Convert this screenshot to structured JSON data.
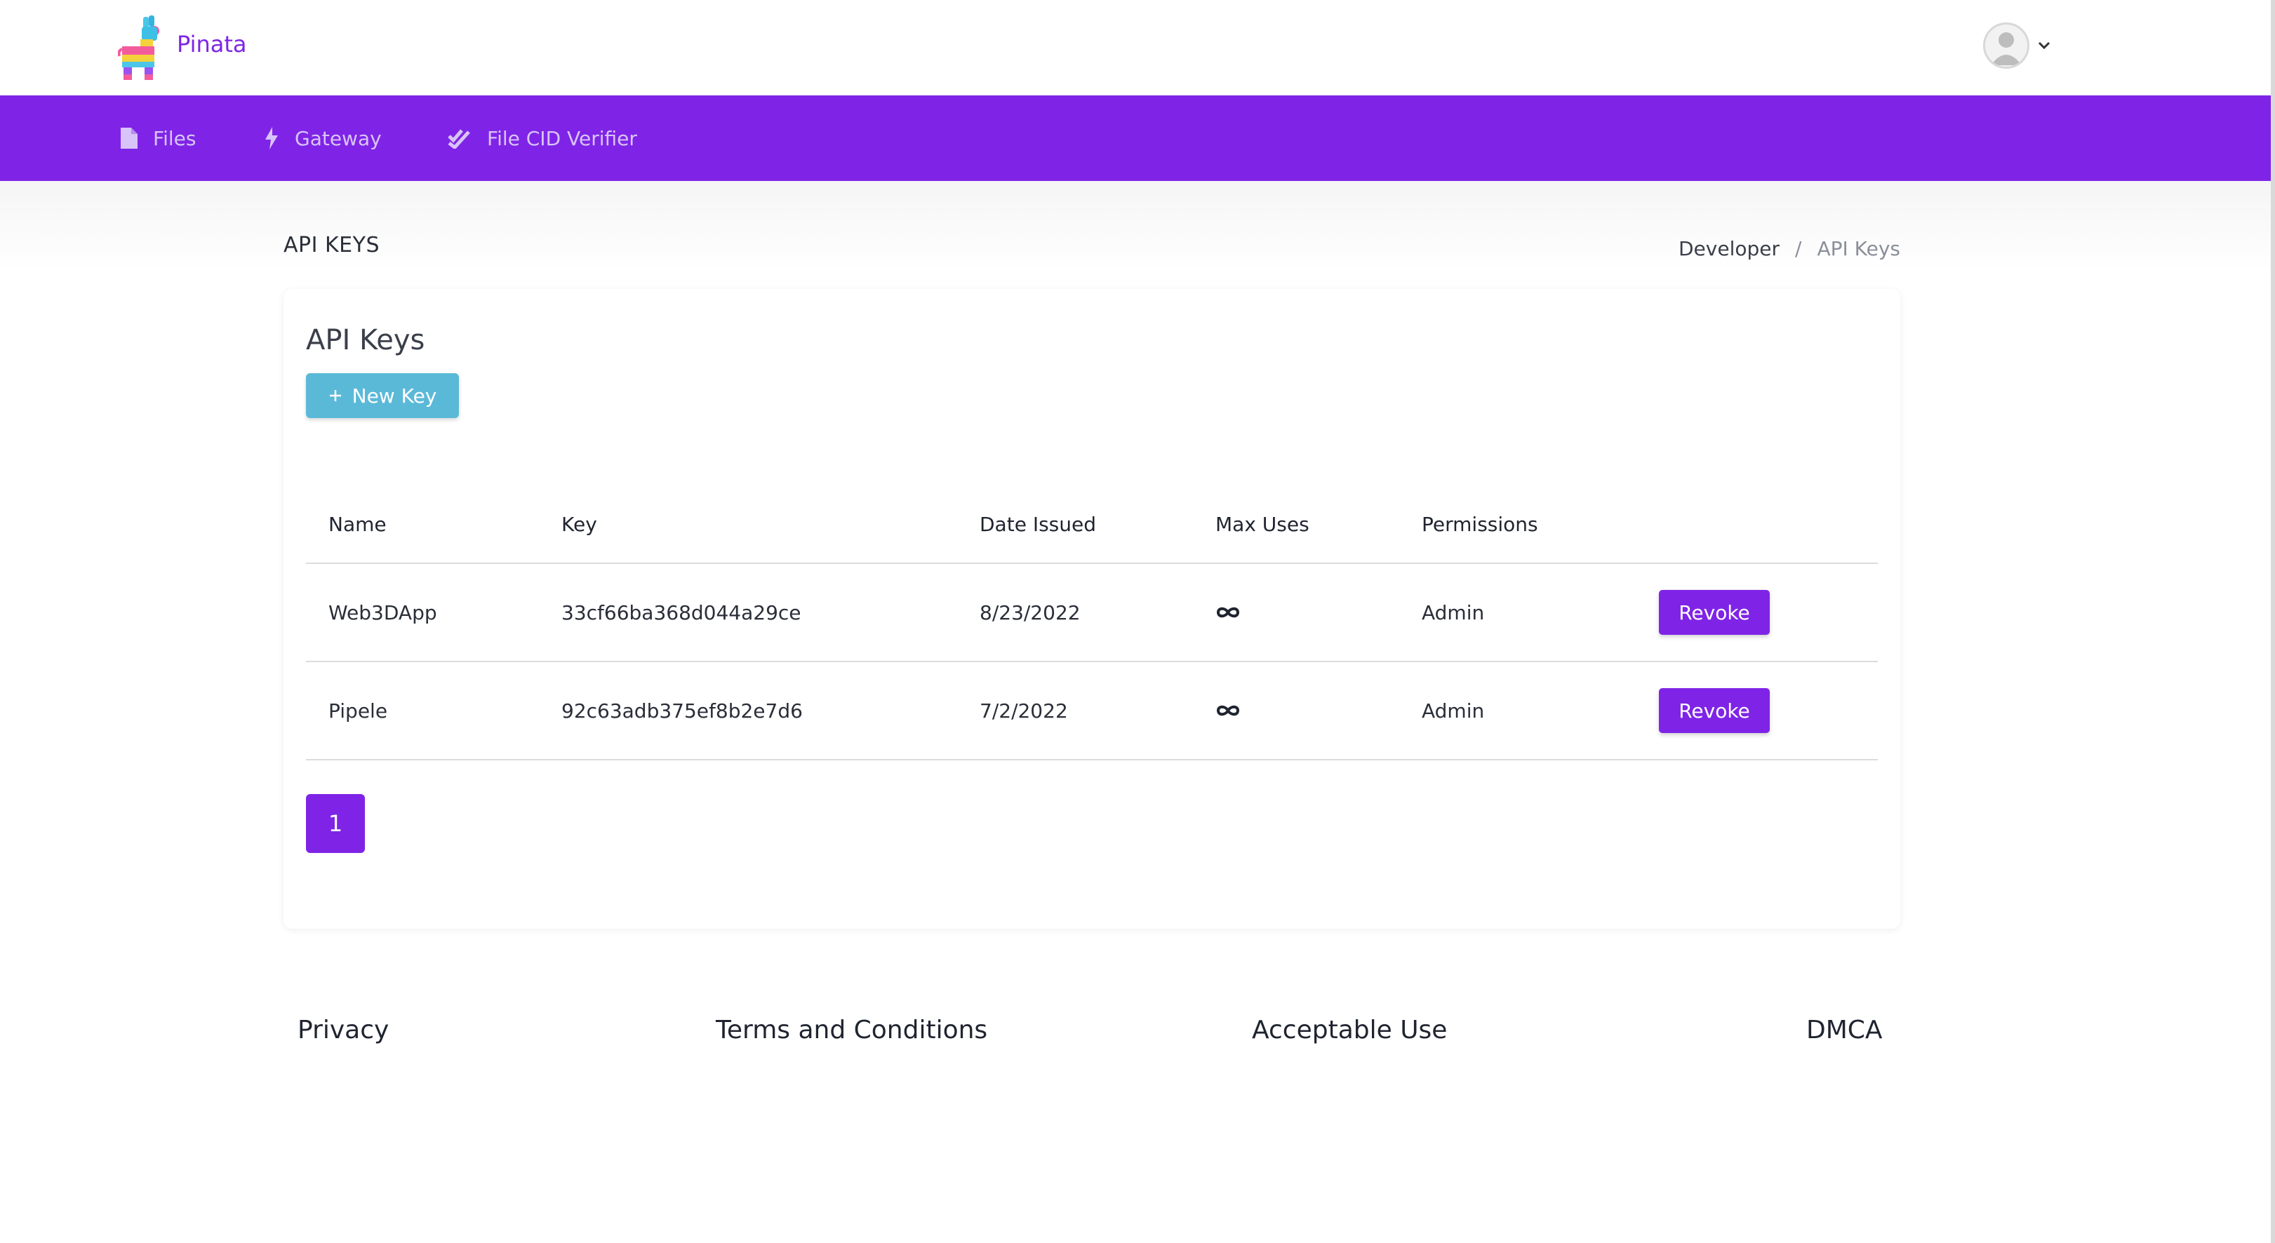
{
  "header": {
    "brand": "Pinata",
    "avatar_icon": "user-avatar-icon",
    "dropdown_icon": "chevron-down-icon"
  },
  "nav": {
    "items": [
      {
        "label": "Files",
        "icon": "file-icon"
      },
      {
        "label": "Gateway",
        "icon": "bolt-icon"
      },
      {
        "label": "File CID Verifier",
        "icon": "double-check-icon"
      }
    ]
  },
  "page": {
    "heading": "API KEYS",
    "breadcrumb": [
      "Developer",
      "/",
      "API Keys"
    ]
  },
  "card": {
    "title": "API Keys",
    "new_key_label": "New Key",
    "new_key_icon": "plus-icon",
    "columns": [
      "Name",
      "Key",
      "Date Issued",
      "Max Uses",
      "Permissions"
    ],
    "rows": [
      {
        "name": "Web3DApp",
        "key": "33cf66ba368d044a29ce",
        "date": "8/23/2022",
        "max_uses_icon": "infinity-icon",
        "permissions": "Admin",
        "action": "Revoke"
      },
      {
        "name": "Pipele",
        "key": "92c63adb375ef8b2e7d6",
        "date": "7/2/2022",
        "max_uses_icon": "infinity-icon",
        "permissions": "Admin",
        "action": "Revoke"
      }
    ],
    "pagination": {
      "current_page": "1"
    }
  },
  "footer": {
    "links": [
      "Privacy",
      "Terms and Conditions",
      "Acceptable Use",
      "DMCA"
    ]
  },
  "colors": {
    "accent": "#7f24e6",
    "button_blue": "#5bb9d8"
  }
}
